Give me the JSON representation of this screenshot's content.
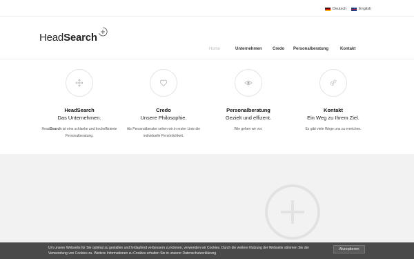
{
  "topbar": {
    "languages": [
      {
        "label": "Deutsch"
      },
      {
        "label": "English"
      }
    ]
  },
  "header": {
    "logo_light": "Head",
    "logo_bold": "Search",
    "nav": [
      {
        "label": "Home"
      },
      {
        "label": "Unternehmen"
      },
      {
        "label": "Credo"
      },
      {
        "label": "Personalberatung"
      },
      {
        "label": "Kontakt"
      }
    ]
  },
  "features": [
    {
      "icon": "move-arrows-icon",
      "title": "HeadSearch",
      "subtitle": "Das Unternehmen.",
      "text_pre": "Head",
      "text_bold": "Search",
      "text_post": " ist eine schlanke und hocheffiziente Personalberatung."
    },
    {
      "icon": "heart-icon",
      "title": "Credo",
      "subtitle": "Unsere Philosophie.",
      "text": "Als Personalberater sehen wir in erster Linie die individuelle Persönlichkeit."
    },
    {
      "icon": "eye-icon",
      "title": "Personalberatung",
      "subtitle": "Gezielt und effizent.",
      "text": "Wie gehen wir vor."
    },
    {
      "icon": "gears-icon",
      "title": "Kontakt",
      "subtitle": "Ein Weg zu Ihrem Ziel.",
      "text": "Es gibt viele Wege uns zu erreichen."
    }
  ],
  "cookie": {
    "text": "Um unsere Webseite für Sie optimal zu gestalten und fortlaufend verbessern zu können, verwenden wir Cookies. Durch die weitere Nutzung der Webseite stimmen Sie der Verwendung von Cookies zu. Weitere Informationen zu Cookies erhalten Sie in unserer Datenschutzerklärung",
    "button": "Akzeptieren"
  },
  "colors": {
    "accent_gray": "#4a4a4a",
    "section_bg": "#f2f2f2"
  }
}
